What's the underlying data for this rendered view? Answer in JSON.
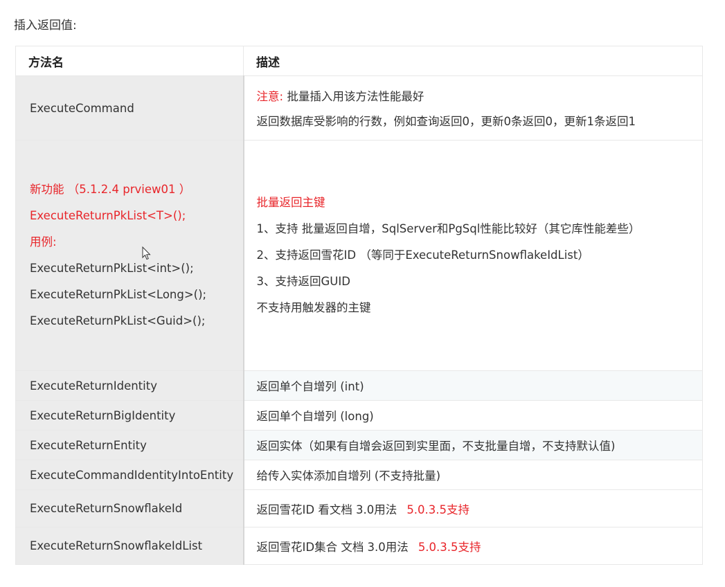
{
  "heading": "插入返回值:",
  "table": {
    "header": {
      "col1": "方法名",
      "col2": "描述"
    },
    "rows": [
      {
        "method": "ExecuteCommand",
        "desc_note_label": "注意:",
        "desc_note_text": "批量插入用该方法性能最好",
        "desc_text": "返回数据库受影响的行数，例如查询返回0，更新0条返回0，更新1条返回1"
      },
      {
        "method_lines_red": [
          "新功能  （5.1.2.4 prview01 ）",
          "ExecuteReturnPkList<T>();",
          "用例:"
        ],
        "method_lines": [
          "ExecuteReturnPkList<int>();",
          "ExecuteReturnPkList<Long>();",
          "ExecuteReturnPkList<Guid>();"
        ],
        "desc_title": "批量返回主键",
        "desc_lines": [
          "1、支持 批量返回自增，SqlServer和PgSql性能比较好（其它库性能差些）",
          "2、支持返回雪花ID （等同于ExecuteReturnSnowflakeIdList）",
          "3、支持返回GUID",
          "不支持用触发器的主键"
        ]
      },
      {
        "method": "ExecuteReturnIdentity",
        "desc": "返回单个自增列 (int)"
      },
      {
        "method": "ExecuteReturnBigIdentity",
        "desc": "返回单个自增列 (long)"
      },
      {
        "method": "ExecuteReturnEntity",
        "desc": "返回实体（如果有自增会返回到实里面，不支批量自增，不支持默认值)"
      },
      {
        "method": "ExecuteCommandIdentityIntoEntity",
        "desc": "给传入实体添加自增列   (不支持批量)"
      },
      {
        "method": "ExecuteReturnSnowflakeId",
        "desc": "返回雪花ID 看文档 3.0用法",
        "desc_red": "5.0.3.5支持"
      },
      {
        "method": "ExecuteReturnSnowflakeIdList",
        "desc": "返回雪花ID集合 文档 3.0用法",
        "desc_red": "5.0.3.5支持"
      }
    ]
  },
  "colors": {
    "accent_red": "#e8252a",
    "name_column_bg": "#ececec",
    "border": "#e8e8e8"
  },
  "icons": {
    "cursor": "mouse-pointer-icon"
  }
}
